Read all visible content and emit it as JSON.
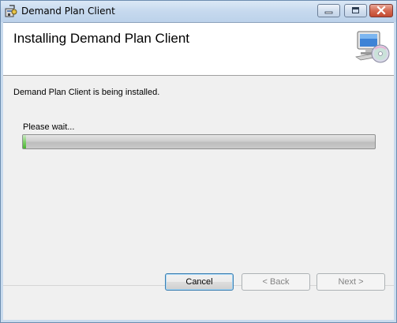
{
  "window": {
    "title": "Demand Plan Client"
  },
  "banner": {
    "title": "Installing Demand Plan Client",
    "icon": "computer-cd-icon"
  },
  "body": {
    "status_text": "Demand Plan Client is being installed.",
    "wait_label": "Please wait...",
    "progress_fraction": 0.01
  },
  "buttons": {
    "cancel": "Cancel",
    "back": "< Back",
    "next": "Next >"
  },
  "colors": {
    "progress_fill": "#4cb334",
    "title_bar": "#c6d9ee",
    "close_button": "#c24a30"
  }
}
